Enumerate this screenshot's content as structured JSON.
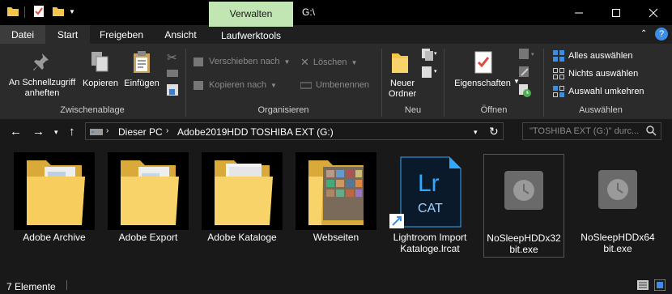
{
  "title_bar": {
    "context_tab": "Verwalten",
    "title": "G:\\"
  },
  "tabs": [
    "Datei",
    "Start",
    "Freigeben",
    "Ansicht",
    "Laufwerktools"
  ],
  "ribbon": {
    "clipboard": {
      "pin": "An Schnellzugriff anheften",
      "copy": "Kopieren",
      "paste": "Einfügen",
      "label": "Zwischenablage"
    },
    "organize": {
      "move": "Verschieben nach",
      "copy_to": "Kopieren nach",
      "delete": "Löschen",
      "rename": "Umbenennen",
      "label": "Organisieren"
    },
    "new": {
      "folder": "Neuer Ordner",
      "label": "Neu"
    },
    "open": {
      "properties": "Eigenschaften",
      "label": "Öffnen"
    },
    "select": {
      "all": "Alles auswählen",
      "none": "Nichts auswählen",
      "invert": "Auswahl umkehren",
      "label": "Auswählen"
    }
  },
  "address": {
    "crumbs": [
      "Dieser PC",
      "Adobe2019HDD TOSHIBA EXT (G:)"
    ],
    "search_placeholder": "\"TOSHIBA EXT (G:)\" durc..."
  },
  "files": [
    {
      "name": "Adobe Archive",
      "icon": "folder-icon"
    },
    {
      "name": "Adobe Export",
      "icon": "folder-icon"
    },
    {
      "name": "Adobe Kataloge",
      "icon": "folder-icon"
    },
    {
      "name": "Webseiten",
      "icon": "folder-icon"
    },
    {
      "name": "Lightroom Import Kataloge.lrcat",
      "icon": "lightroom-catalog-icon",
      "icon_text_top": "Lr",
      "icon_text_bottom": "CAT"
    },
    {
      "name": "NoSleepHDDx32 bit.exe",
      "icon": "exe-icon"
    },
    {
      "name": "NoSleepHDDx64 bit.exe",
      "icon": "exe-icon"
    }
  ],
  "status": {
    "count": "7 Elemente"
  },
  "colors": {
    "verwalten": "#c2e6b3",
    "folder": "#f5c64b",
    "lightroom": "#0a1a2a",
    "lightroom_accent": "#31a8ff"
  }
}
